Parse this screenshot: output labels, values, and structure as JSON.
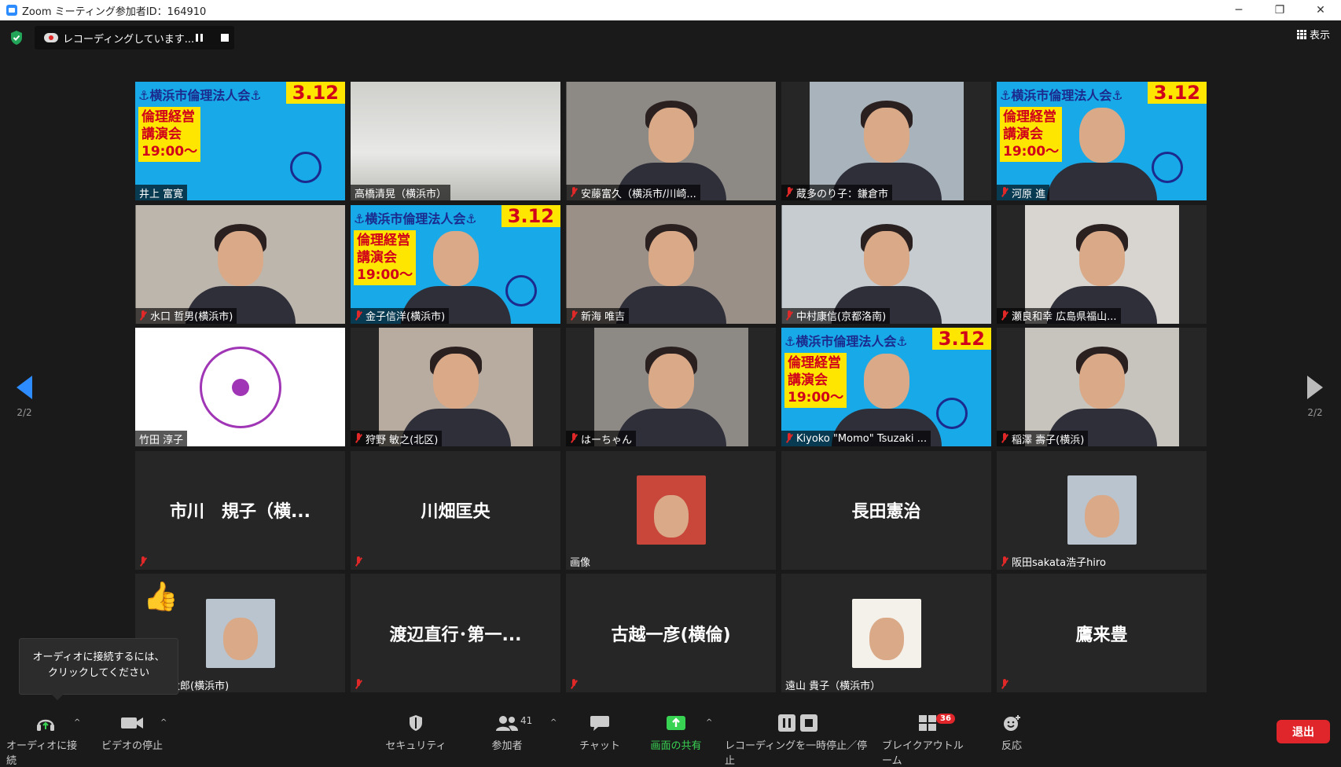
{
  "window": {
    "title": "Zoom ミーティング参加者ID：164910",
    "minimize": "─",
    "restore": "❐",
    "close": "✕"
  },
  "topbar": {
    "recording_text": "レコーディングしています...",
    "view_label": "表示"
  },
  "navigation": {
    "page_left": "2/2",
    "page_right": "2/2"
  },
  "colors": {
    "accent": "#2d8cff",
    "muted": "#e02828",
    "poster_blue": "#18a9e8",
    "poster_yellow": "#ffe600",
    "leave": "#e0262a",
    "share_green": "#39d353"
  },
  "poster": {
    "title": "⚓横浜市倫理法人会⚓",
    "date": "3.12",
    "line1": "倫理経営",
    "line2": "講演会",
    "line3": "19:00～"
  },
  "tiles": [
    {
      "name": "井上 富寛",
      "kind": "poster",
      "muted": false
    },
    {
      "name": "高橋清晃（横浜市）",
      "kind": "room",
      "muted": false
    },
    {
      "name": "安藤富久（横浜市/川崎...",
      "kind": "person",
      "muted": true
    },
    {
      "name": "蔵多のり子：鎌倉市",
      "kind": "person",
      "muted": true
    },
    {
      "name": "河原 進",
      "kind": "poster_person",
      "muted": true
    },
    {
      "name": "水口 哲男(横浜市)",
      "kind": "person",
      "muted": true
    },
    {
      "name": "金子信洋(横浜市)",
      "kind": "poster_person",
      "muted": true
    },
    {
      "name": "新海 唯吉",
      "kind": "person",
      "muted": true
    },
    {
      "name": "中村康信(京都洛南)",
      "kind": "person",
      "muted": true
    },
    {
      "name": "瀬良和幸 広島県福山...",
      "kind": "person",
      "muted": true
    },
    {
      "name": "竹田 淳子",
      "kind": "emblem",
      "muted": false
    },
    {
      "name": "狩野 敏之(北区)",
      "kind": "person",
      "muted": true
    },
    {
      "name": "はーちゃん",
      "kind": "person",
      "muted": true
    },
    {
      "name": "Kiyoko \"Momo\" Tsuzaki ...",
      "kind": "poster_person",
      "muted": true
    },
    {
      "name": "稲澤 壽子(横浜)",
      "kind": "person",
      "muted": true
    },
    {
      "center": "市川　規子（横...",
      "kind": "text",
      "muted": true
    },
    {
      "center": "川畑匡央",
      "kind": "text",
      "muted": true
    },
    {
      "name": "画像",
      "kind": "thumb",
      "muted": false
    },
    {
      "center": "長田憲治",
      "kind": "text",
      "muted": false
    },
    {
      "name": "阪田sakata浩子hiro",
      "kind": "thumb",
      "muted": true
    },
    {
      "name": "け山本太郎(横浜市)",
      "kind": "thumb_reaction",
      "muted": false,
      "reaction": "👍"
    },
    {
      "center": "渡辺直行･第一...",
      "kind": "text",
      "muted": true
    },
    {
      "center": "古越一彦(横倫)",
      "kind": "text",
      "muted": true
    },
    {
      "name": "遠山 貴子（横浜市）",
      "kind": "thumb",
      "muted": false
    },
    {
      "center": "鷹来豊",
      "kind": "text",
      "muted": true
    }
  ],
  "tooltip": {
    "text": "オーディオに接続するには、クリックしてください"
  },
  "toolbar": {
    "audio": "オーディオに接続",
    "video": "ビデオの停止",
    "security": "セキュリティ",
    "participants": "参加者",
    "participants_count": "41",
    "chat": "チャット",
    "share": "画面の共有",
    "recording": "レコーディングを一時停止／停止",
    "breakout": "ブレイクアウトルーム",
    "breakout_count": "36",
    "reactions": "反応",
    "leave": "退出"
  }
}
